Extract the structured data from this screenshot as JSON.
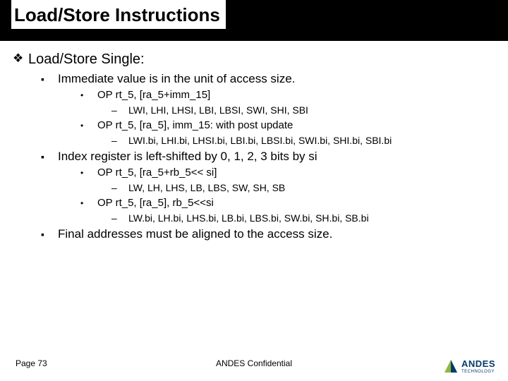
{
  "title": "Load/Store Instructions",
  "section": "Load/Store Single:",
  "bullets": {
    "b1": "Immediate value is in the unit of access size.",
    "b1a": "OP   rt_5, [ra_5+imm_15]",
    "b1a1": "LWI, LHI, LHSI, LBI, LBSI, SWI, SHI, SBI",
    "b1b": "OP   rt_5, [ra_5], imm_15: with post update",
    "b1b1": "LWI.bi, LHI.bi, LHSI.bi, LBI.bi, LBSI.bi, SWI.bi, SHI.bi, SBI.bi",
    "b2": "Index register is left-shifted by 0, 1, 2, 3 bits by si",
    "b2a": "OP   rt_5, [ra_5+rb_5<< si]",
    "b2a1": "LW, LH, LHS, LB, LBS, SW, SH, SB",
    "b2b": "OP   rt_5, [ra_5], rb_5<<si",
    "b2b1": "LW.bi, LH.bi, LHS.bi, LB.bi, LBS.bi, SW.bi, SH.bi, SB.bi",
    "b3": "Final addresses must be aligned to the access size."
  },
  "footer": {
    "page": "Page 73",
    "conf": "ANDES Confidential",
    "logo_main": "ANDES",
    "logo_sub": "TECHNOLOGY"
  }
}
